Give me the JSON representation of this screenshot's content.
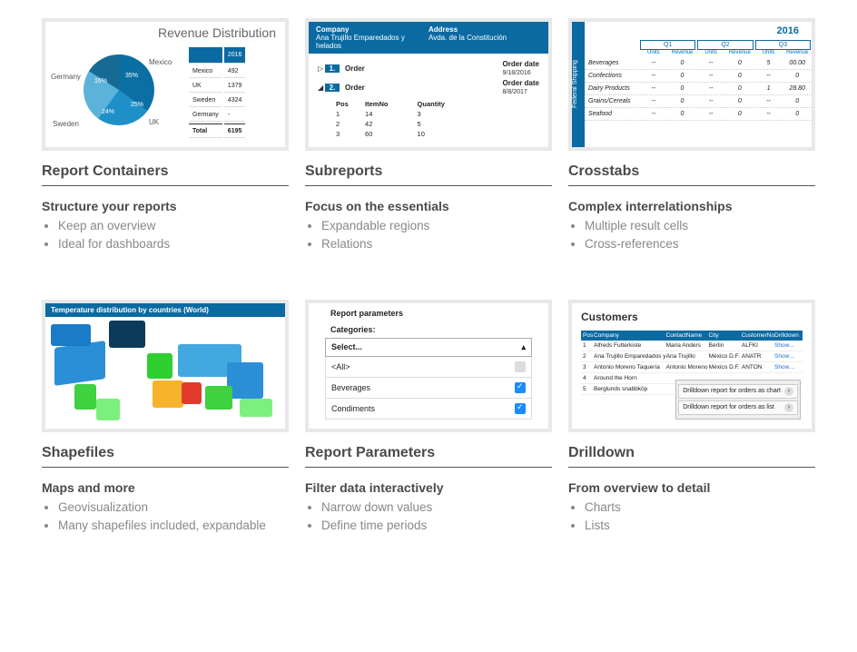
{
  "cards": [
    {
      "title": "Report Containers",
      "subtitle": "Structure your reports",
      "bullets": [
        "Keep an overview",
        "Ideal for dashboards"
      ]
    },
    {
      "title": "Subreports",
      "subtitle": "Focus on the essentials",
      "bullets": [
        "Expandable regions",
        "Relations"
      ]
    },
    {
      "title": "Crosstabs",
      "subtitle": "Complex interrelationships",
      "bullets": [
        "Multiple result cells",
        "Cross-references"
      ]
    },
    {
      "title": "Shapefiles",
      "subtitle": "Maps and more",
      "bullets": [
        "Geovisualization",
        "Many shapefiles included, expandable"
      ]
    },
    {
      "title": "Report Parameters",
      "subtitle": "Filter data interactively",
      "bullets": [
        "Narrow down values",
        "Define time periods"
      ]
    },
    {
      "title": "Drilldown",
      "subtitle": "From overview to detail",
      "bullets": [
        "Charts",
        "Lists"
      ]
    }
  ],
  "thumb1": {
    "title": "Revenue Distribution",
    "labels": {
      "mexico": "Mexico",
      "germany": "Germany",
      "sweden": "Sweden",
      "uk": "UK"
    },
    "pct": {
      "mexico": "35%",
      "uk": "25%",
      "sweden": "24%",
      "germany": "16%"
    },
    "year": "2016",
    "rows": [
      [
        "Mexico",
        "492"
      ],
      [
        "UK",
        "1379"
      ],
      [
        "Sweden",
        "4324"
      ],
      [
        "Germany",
        "-"
      ]
    ],
    "total": [
      "Total",
      "6195"
    ]
  },
  "thumb2": {
    "h_company": "Company",
    "h_addr": "Address",
    "company": "Ana Trujillo Emparedados y helados",
    "addr": "Avda. de la Constitución",
    "orders": [
      {
        "tri": "▷",
        "n": "1.",
        "label": "Order",
        "odl": "Order date",
        "date": "9/18/2016"
      },
      {
        "tri": "◢",
        "n": "2.",
        "label": "Order",
        "odl": "Order date",
        "date": "8/8/2017"
      }
    ],
    "items_h": [
      "Pos",
      "ItemNo",
      "Quantity"
    ],
    "items": [
      [
        "1",
        "14",
        "3"
      ],
      [
        "2",
        "42",
        "5"
      ],
      [
        "3",
        "60",
        "10"
      ]
    ]
  },
  "thumb3": {
    "side": "Federal Shipping",
    "year": "2016",
    "q": [
      "Q1",
      "Q2",
      "Q3"
    ],
    "sub": [
      "Units",
      "Revenue",
      "Units",
      "Revenue",
      "Units",
      "Revenue"
    ],
    "rows": [
      [
        "Beverages",
        "--",
        "0",
        "--",
        "0",
        "5",
        "00.00"
      ],
      [
        "Confections",
        "--",
        "0",
        "--",
        "0",
        "--",
        "0"
      ],
      [
        "Dairy Products",
        "--",
        "0",
        "--",
        "0",
        "1",
        "28.80"
      ],
      [
        "Grains/Cereals",
        "--",
        "0",
        "--",
        "0",
        "--",
        "0"
      ],
      [
        "Seafood",
        "--",
        "0",
        "--",
        "0",
        "--",
        "0"
      ]
    ]
  },
  "thumb4": {
    "title": "Temperature distribution by countries (World)"
  },
  "thumb5": {
    "title": "Report parameters",
    "cat": "Categories:",
    "select": "Select...",
    "opts": [
      {
        "l": "<All>",
        "c": false
      },
      {
        "l": "Beverages",
        "c": true
      },
      {
        "l": "Condiments",
        "c": true
      }
    ]
  },
  "thumb6": {
    "title": "Customers",
    "cols": [
      "Pos",
      "Company",
      "ContactName",
      "City",
      "CustomerNo",
      "Drilldown"
    ],
    "rows": [
      [
        "1",
        "Alfreds Futterkiste",
        "Maria Anders",
        "Berlin",
        "ALFKI",
        "Show…"
      ],
      [
        "2",
        "Ana Trujillo Emparedados y",
        "Ana Trujillo",
        "México D.F.",
        "ANATR",
        "Show…"
      ],
      [
        "3",
        "Antonio Moreno Taquería",
        "Antonio Moreno",
        "México D.F.",
        "ANTON",
        "Show…"
      ],
      [
        "4",
        "Around the Horn",
        "",
        "",
        "",
        ""
      ],
      [
        "5",
        "Berglunds snabbköp",
        "",
        "",
        "",
        ""
      ]
    ],
    "popup": [
      "Drilldown report for orders as chart",
      "Drilldown report for orders as list"
    ]
  },
  "chart_data": {
    "type": "pie",
    "title": "Revenue Distribution",
    "series": [
      {
        "name": "2016",
        "categories": [
          "Mexico",
          "UK",
          "Sweden",
          "Germany"
        ],
        "values": [
          35,
          25,
          24,
          16
        ]
      }
    ]
  }
}
